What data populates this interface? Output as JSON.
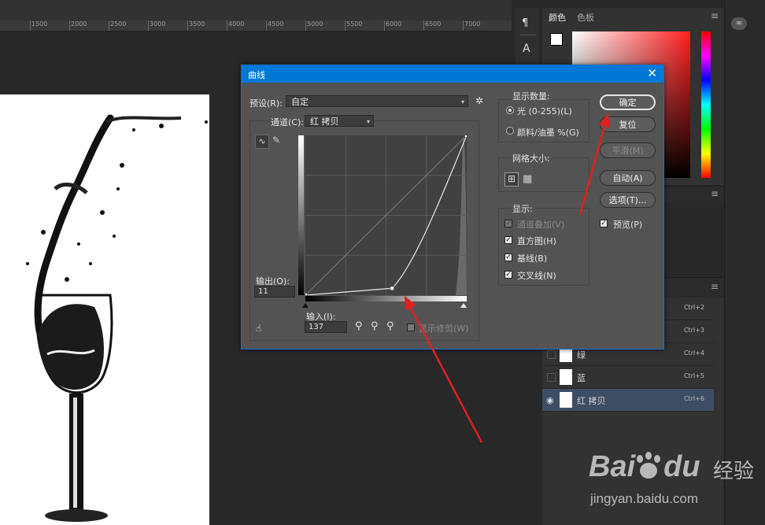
{
  "ruler": {
    "labels": [
      "1500",
      "2000",
      "2500",
      "3000",
      "3500",
      "4000",
      "4500",
      "5000",
      "5500",
      "6000",
      "6500",
      "7000"
    ]
  },
  "color_panel": {
    "tabs": [
      "颜色",
      "色板"
    ]
  },
  "layers": [
    {
      "name": "",
      "shortcut": "Ctrl+2",
      "visible": false
    },
    {
      "name": "",
      "shortcut": "Ctrl+3",
      "visible": false
    },
    {
      "name": "绿",
      "shortcut": "Ctrl+4",
      "visible": false
    },
    {
      "name": "蓝",
      "shortcut": "Ctrl+5",
      "visible": false
    },
    {
      "name": "红 拷贝",
      "shortcut": "Ctrl+6",
      "visible": true,
      "selected": true
    }
  ],
  "dialog": {
    "title": "曲线",
    "preset_label": "预设(R):",
    "preset_value": "自定",
    "channel_label": "通道(C):",
    "channel_value": "红 拷贝",
    "output_label": "输出(O):",
    "output_value": "11",
    "input_label": "输入(I):",
    "input_value": "137",
    "show_clipping": "显示修剪(W)",
    "buttons": {
      "ok": "确定",
      "reset": "复位",
      "smooth": "平滑(M)",
      "auto": "自动(A)",
      "options": "选项(T)...",
      "preview": "预览(P)"
    },
    "display_amount": {
      "title": "显示数量:",
      "light": "光 (0-255)(L)",
      "pigment": "颜料/油墨 %(G)"
    },
    "grid_size": {
      "title": "网格大小:"
    },
    "show": {
      "title": "显示:",
      "channel_overlay": "通道叠加(V)",
      "histogram": "直方图(H)",
      "baseline": "基线(B)",
      "intersection": "交叉线(N)"
    },
    "curve_points": [
      {
        "input": 0,
        "output": 0
      },
      {
        "input": 137,
        "output": 11
      },
      {
        "input": 255,
        "output": 255
      }
    ]
  },
  "watermark": {
    "brand": "Bai",
    "brand2": "du",
    "cn": "经验",
    "url": "jingyan.baidu.com"
  },
  "colors": {
    "accent": "#0078d7",
    "arrow": "#e0201f"
  }
}
